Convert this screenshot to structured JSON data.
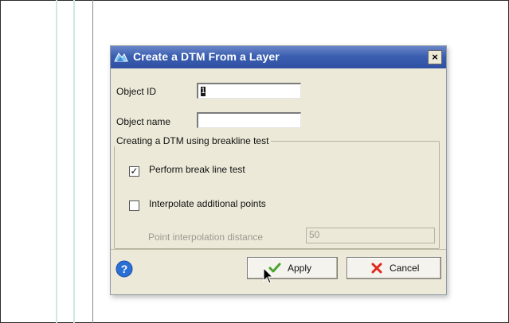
{
  "dialog": {
    "title": "Create a DTM From a Layer",
    "close_label": "×",
    "object_id_label": "Object ID",
    "object_id_value": "1",
    "object_name_label": "Object name",
    "object_name_value": "",
    "group_title": "Creating a DTM using breakline test",
    "perform_break_line_test_label": "Perform break line test",
    "perform_break_line_test_checked": true,
    "interpolate_label": "Interpolate additional points",
    "interpolate_checked": false,
    "interp_distance_label": "Point interpolation distance",
    "interp_distance_value": "50",
    "apply_label": "Apply",
    "cancel_label": "Cancel"
  },
  "icons": {
    "title_icon": "dtm-icon",
    "help_icon": "help-icon",
    "apply_icon": "check-icon",
    "cancel_icon": "x-icon"
  },
  "colors": {
    "titlebar": "#3b5fb1",
    "dialog_bg": "#ece9d8",
    "apply_check": "#4aa52e",
    "cancel_x": "#e0281f"
  }
}
